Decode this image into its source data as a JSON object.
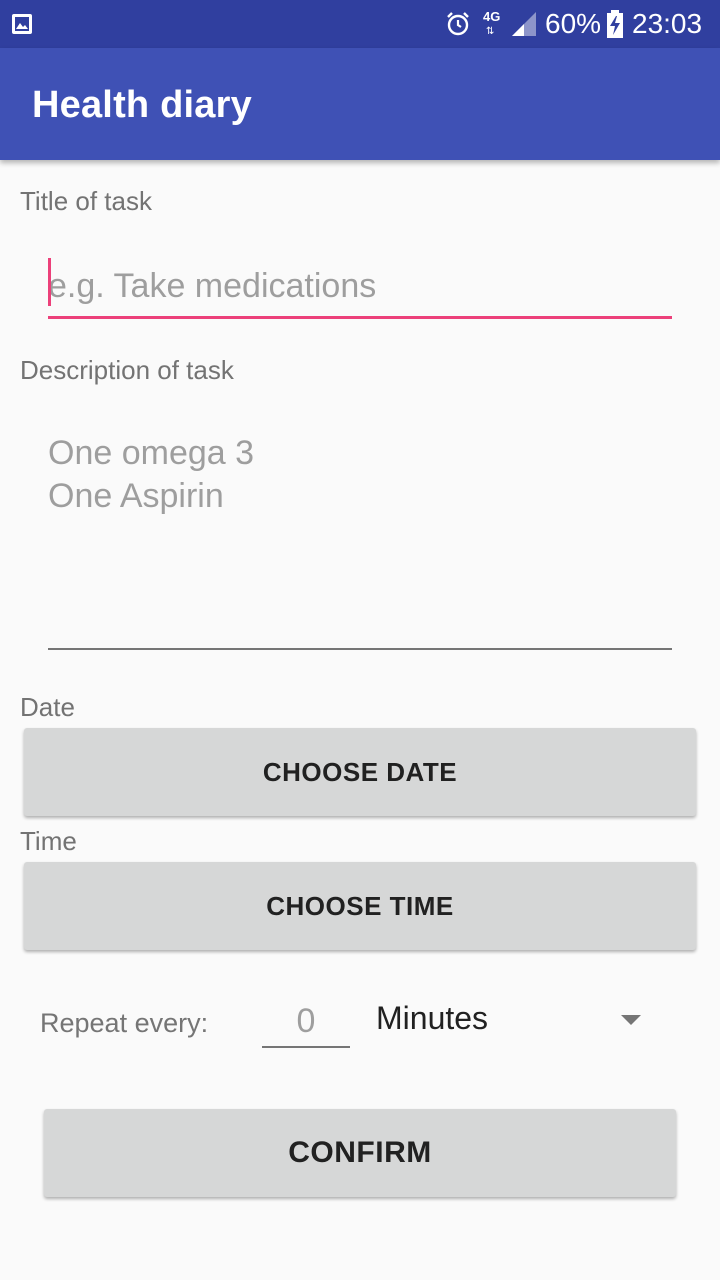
{
  "status_bar": {
    "network": "4G",
    "network_arrows": "⇅",
    "battery_percent": "60%",
    "time": "23:03",
    "icons": [
      "gallery-icon",
      "alarm-icon",
      "signal-icon",
      "battery-charging-icon"
    ]
  },
  "app_bar": {
    "title": "Health diary"
  },
  "form": {
    "title_label": "Title of task",
    "title_placeholder": "e.g. Take medications",
    "description_label": "Description of task",
    "description_placeholder": "One omega 3\nOne Aspirin",
    "date_label": "Date",
    "choose_date_button": "CHOOSE DATE",
    "time_label": "Time",
    "choose_time_button": "CHOOSE TIME",
    "repeat_label": "Repeat every:",
    "repeat_placeholder": "0",
    "repeat_unit_selected": "Minutes",
    "confirm_button": "CONFIRM"
  },
  "colors": {
    "status_bar": "#303f9f",
    "app_bar": "#3f51b5",
    "accent": "#ec407a",
    "button": "#d6d7d7",
    "background": "#fafafa"
  }
}
